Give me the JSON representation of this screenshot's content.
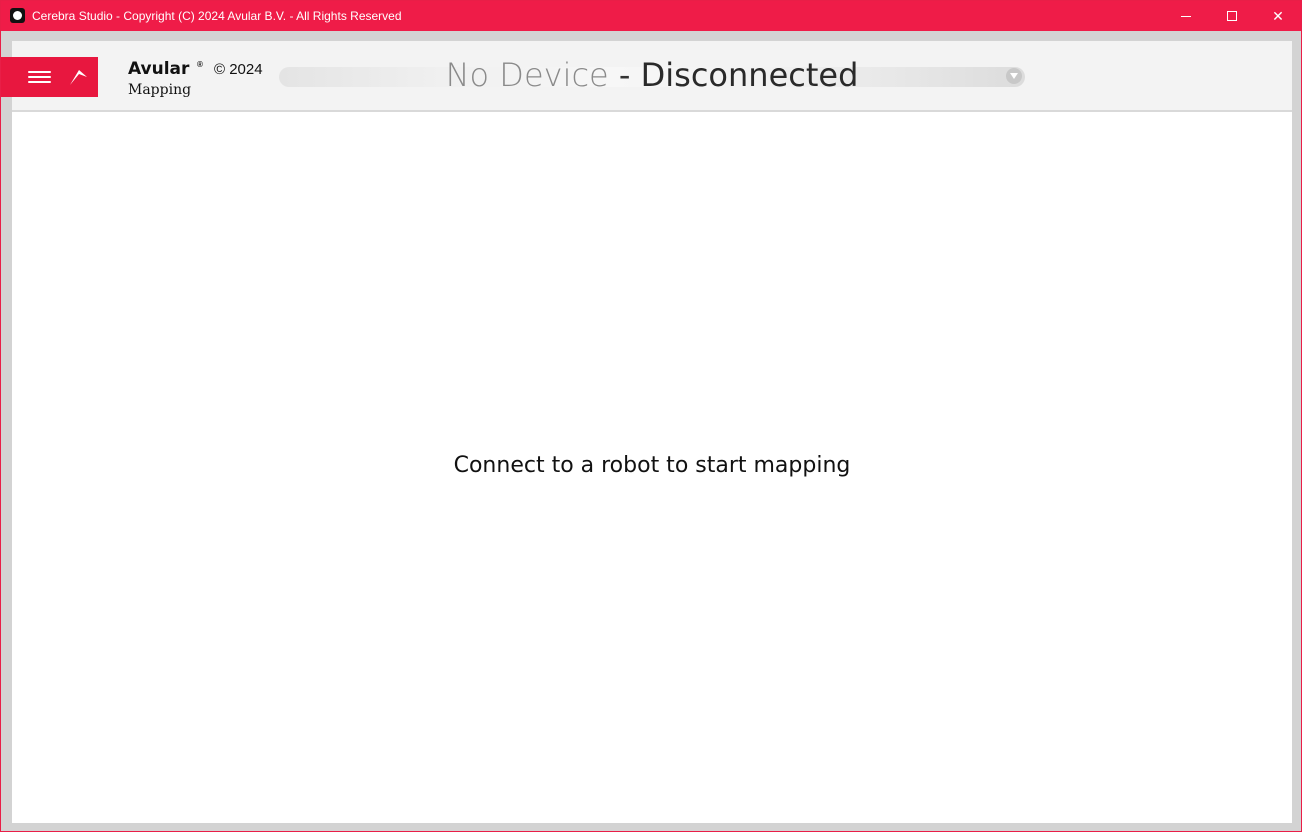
{
  "window": {
    "title": "Cerebra Studio - Copyright (C) 2024 Avular B.V. - All Rights Reserved",
    "controls": {
      "minimize_icon": "minimize-icon",
      "maximize_icon": "maximize-icon",
      "close_icon": "close-icon",
      "close_label": "✕"
    },
    "accent_color": "#ef1c48"
  },
  "header": {
    "brand": "Avular",
    "brand_mark": "®",
    "year": "© 2024",
    "module": "Mapping",
    "menu_icon": "hamburger-menu-icon",
    "logo_icon": "avular-logo-icon"
  },
  "device_selector": {
    "device": "No Device",
    "separator": "-",
    "status": "Disconnected",
    "arrow_icon": "chevron-down-icon"
  },
  "main": {
    "message": "Connect to a robot to start mapping"
  }
}
